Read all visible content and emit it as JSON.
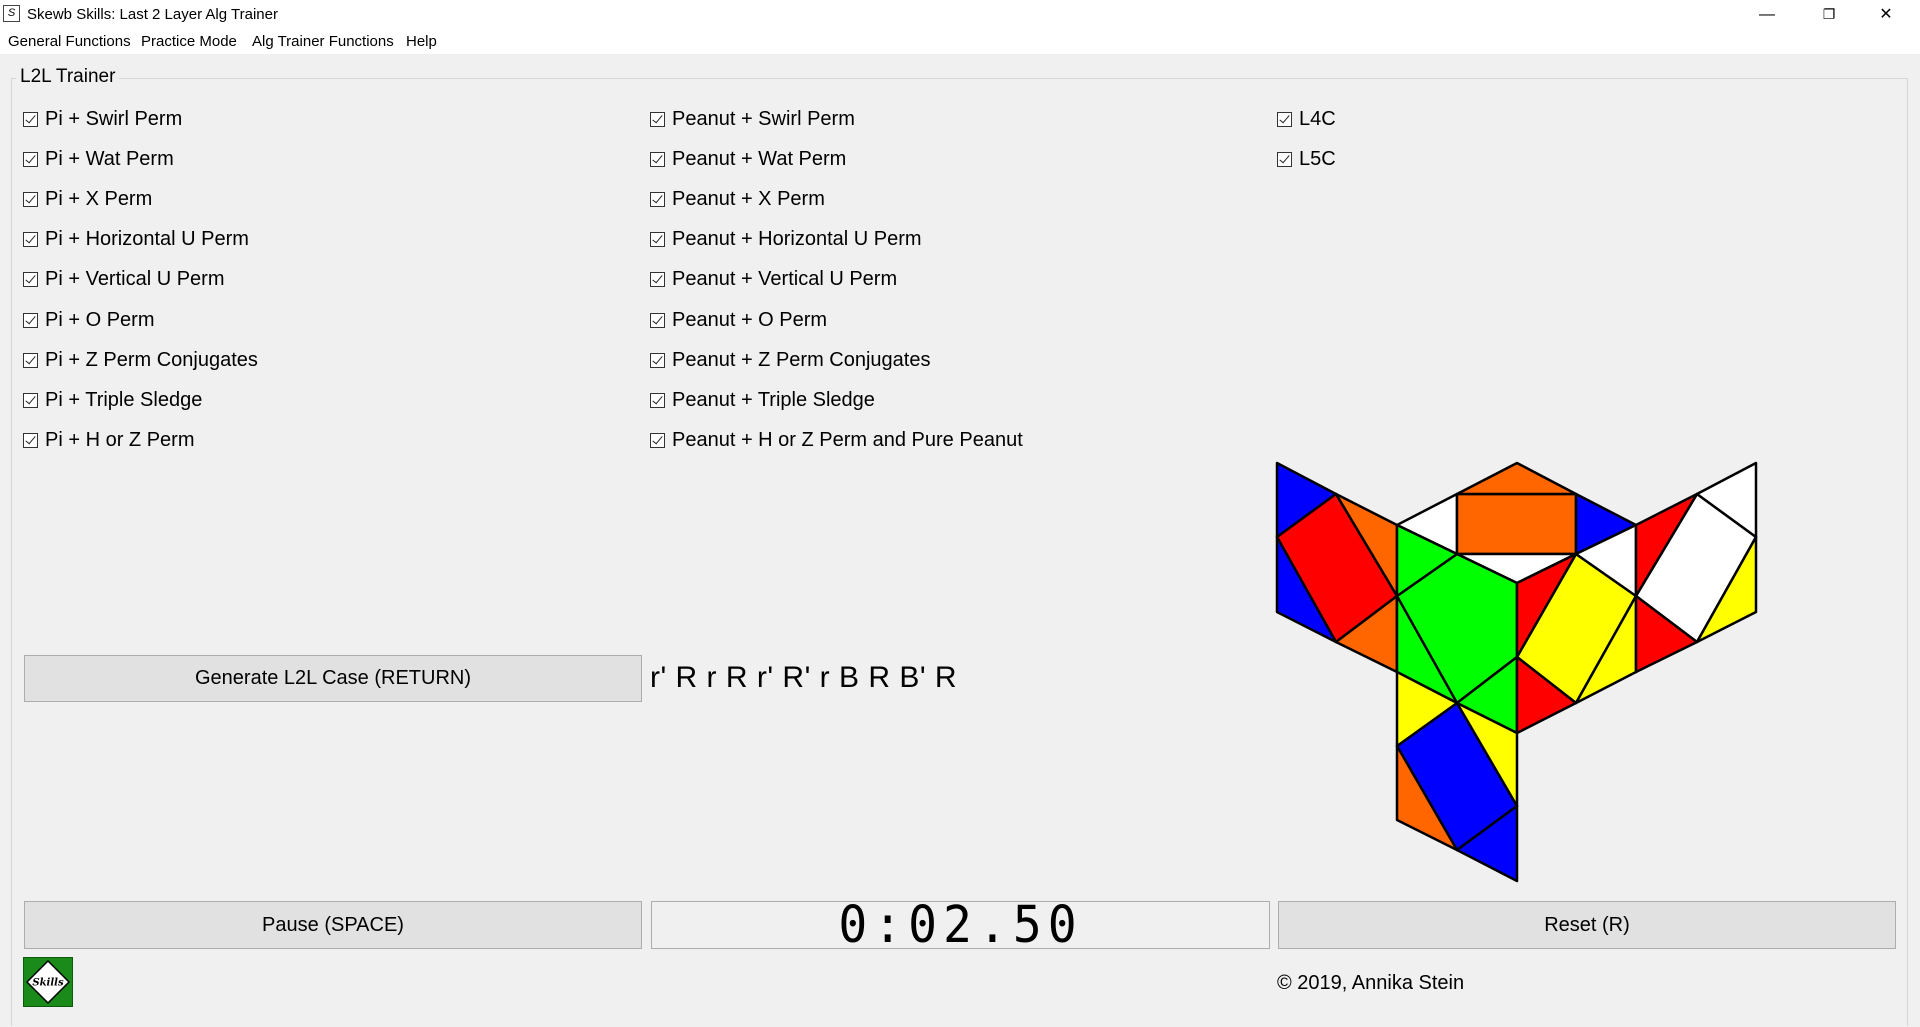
{
  "window": {
    "title": "Skewb Skills: Last 2 Layer Alg Trainer",
    "app_icon_glyph": "S",
    "controls": {
      "minimize": "—",
      "restore": "❐",
      "close": "✕"
    }
  },
  "menu": [
    "General Functions",
    "Practice Mode",
    "Alg Trainer Functions",
    "Help"
  ],
  "group_title": "L2L Trainer",
  "pi_cases": [
    "Pi + Swirl Perm",
    "Pi + Wat Perm",
    "Pi + X Perm",
    "Pi + Horizontal U Perm",
    "Pi + Vertical U Perm",
    "Pi + O Perm",
    "Pi + Z Perm Conjugates",
    "Pi + Triple Sledge",
    "Pi + H or Z Perm"
  ],
  "peanut_cases": [
    "Peanut + Swirl Perm",
    "Peanut + Wat Perm",
    "Peanut + X Perm",
    "Peanut + Horizontal U Perm",
    "Peanut + Vertical U Perm",
    "Peanut + O Perm",
    "Peanut + Z Perm Conjugates",
    "Peanut + Triple Sledge",
    "Peanut + H or Z Perm and Pure Peanut"
  ],
  "other_cases": [
    "L4C",
    "L5C"
  ],
  "checked": true,
  "buttons": {
    "generate": "Generate L2L Case (RETURN)",
    "pause": "Pause (SPACE)",
    "reset": "Reset (R)"
  },
  "scramble": "r' R r R r' R' r B R B' R",
  "timer": "0:02.50",
  "logo_text": "Skills",
  "copyright": "© 2019, Annika Stein",
  "sticker_colors": {
    "blue": "#0000ff",
    "red": "#ff0000",
    "orange": "#ff6600",
    "white": "#ffffff",
    "green": "#00ff00",
    "yellow": "#ffff00"
  }
}
